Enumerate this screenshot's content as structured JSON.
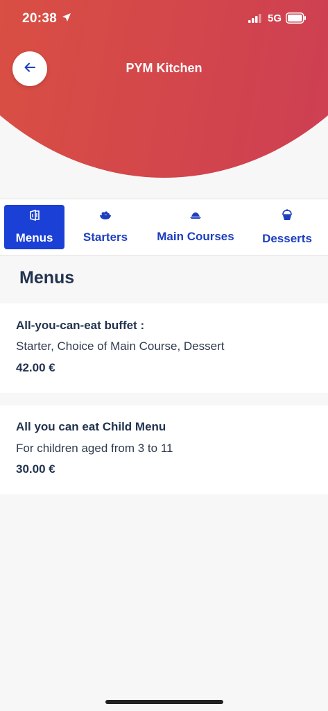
{
  "status_bar": {
    "time": "20:38",
    "network": "5G"
  },
  "header": {
    "title": "PYM Kitchen",
    "back_icon": "arrow-left-icon"
  },
  "tabs": [
    {
      "label": "Menus",
      "icon": "menu-book-icon",
      "active": true
    },
    {
      "label": "Starters",
      "icon": "salad-bowl-icon",
      "active": false
    },
    {
      "label": "Main Courses",
      "icon": "dish-icon",
      "active": false
    },
    {
      "label": "Desserts",
      "icon": "cupcake-icon",
      "active": false
    }
  ],
  "section": {
    "title": "Menus"
  },
  "menus": [
    {
      "name": "All-you-can-eat buffet :",
      "description": "Starter, Choice of Main Course, Dessert",
      "price": "42.00 €"
    },
    {
      "name": "All you can eat Child Menu",
      "description": "For children aged from 3 to 11",
      "price": "30.00 €"
    }
  ],
  "colors": {
    "accent": "#1a40d6",
    "tab_text": "#1d3fbf",
    "header_gradient_start": "#df5a3a",
    "header_gradient_end": "#c93a58",
    "heading_text": "#22334f"
  }
}
